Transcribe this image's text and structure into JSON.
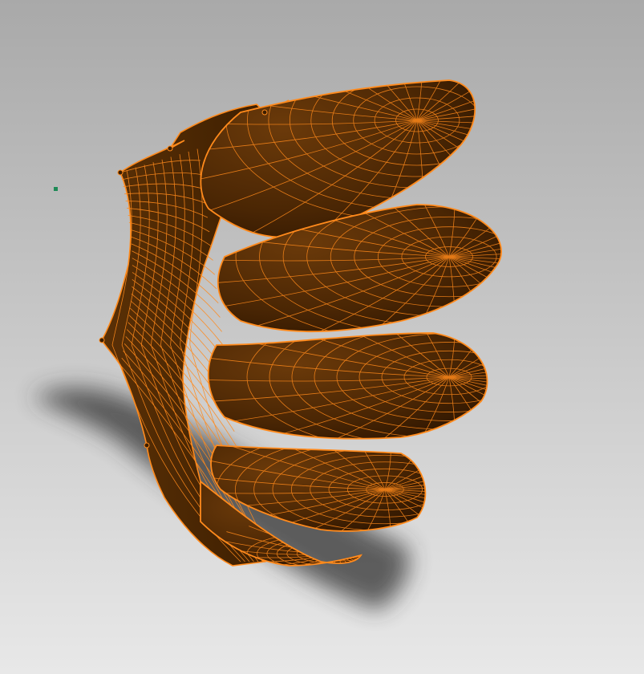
{
  "viewport": {
    "background_top": "#a9a9a9",
    "background_bottom": "#e7e7e7"
  },
  "model": {
    "type": "meshed multi-blade rotor segment",
    "render_mode": "shaded-with-wireframe",
    "surface_color": "#3a1d00",
    "surface_highlight": "#6b3a0a",
    "wire_color": "#ff8a1c",
    "blade_count": 5,
    "shadow_color": "#333333"
  },
  "marker": {
    "color": "#1e8a56",
    "icon": "pivot-marker-icon"
  }
}
